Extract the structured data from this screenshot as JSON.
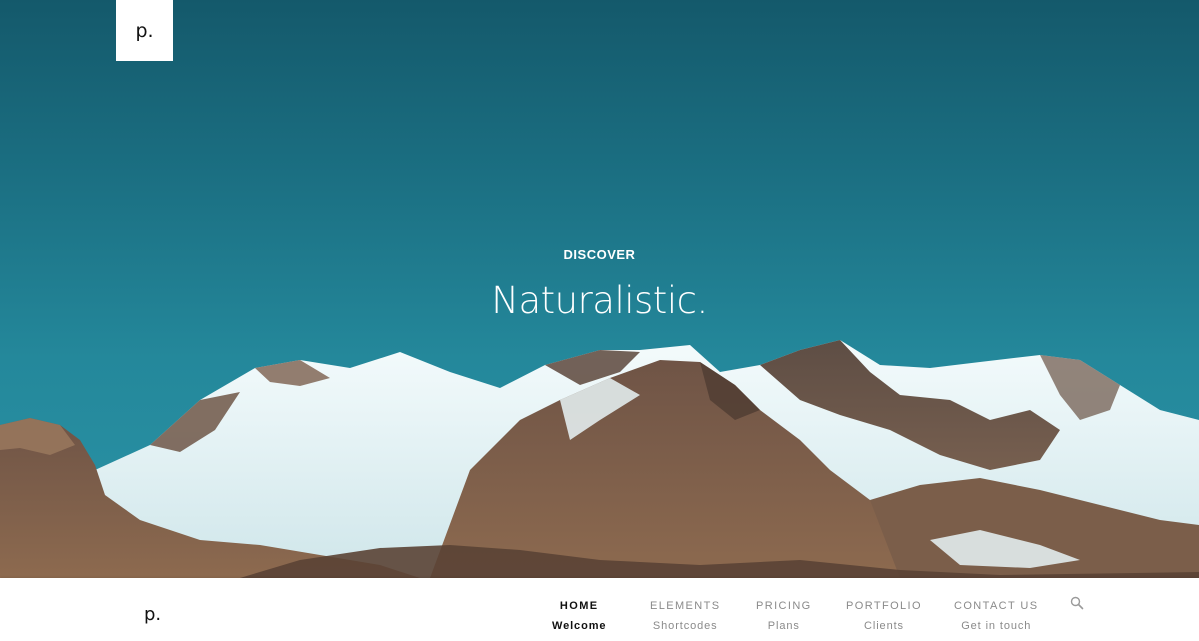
{
  "hero": {
    "logo": "p.",
    "kicker": "DISCOVER",
    "headline": "Naturalistic."
  },
  "nav": {
    "logo": "p.",
    "items": [
      {
        "label": "HOME",
        "sub": "Welcome",
        "active": true
      },
      {
        "label": "ELEMENTS",
        "sub": "Shortcodes",
        "active": false
      },
      {
        "label": "PRICING",
        "sub": "Plans",
        "active": false
      },
      {
        "label": "PORTFOLIO",
        "sub": "Clients",
        "active": false
      },
      {
        "label": "CONTACT US",
        "sub": "Get in touch",
        "active": false
      }
    ],
    "search_icon": "search-icon"
  },
  "colors": {
    "sky": "#1b6f82",
    "snow": "#e9f5f7",
    "rock": "#8a6a55",
    "nav_active": "#111111",
    "nav_inactive": "#8a8a8a"
  }
}
